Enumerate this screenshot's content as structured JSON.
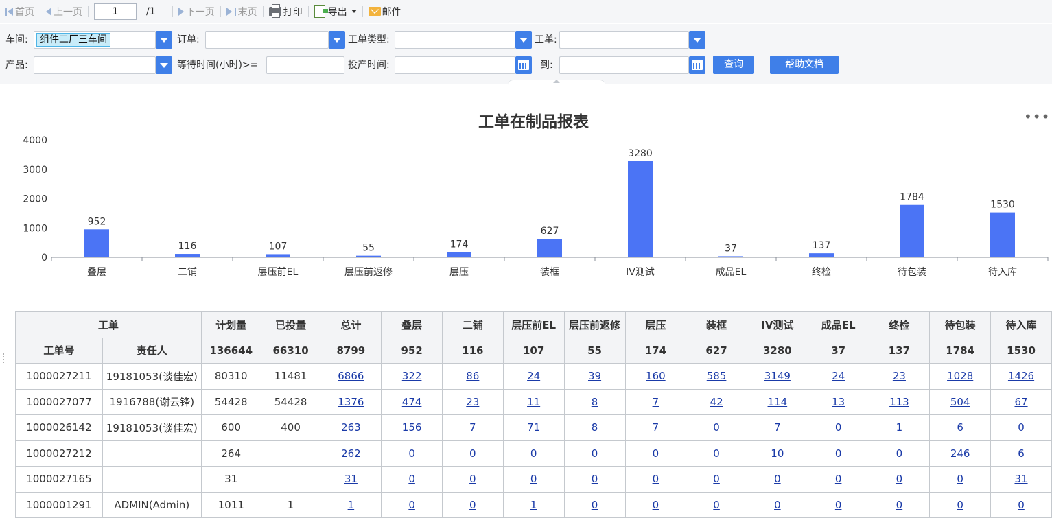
{
  "toolbar": {
    "first_label": "首页",
    "prev_label": "上一页",
    "page_value": "1",
    "page_total": "/1",
    "next_label": "下一页",
    "last_label": "末页",
    "print_label": "打印",
    "export_label": "导出",
    "mail_label": "邮件"
  },
  "filters": {
    "workshop_label": "车间:",
    "workshop_value": "组件二厂三车间",
    "order_label": "订单:",
    "wo_type_label": "工单类型:",
    "wo_label": "工单:",
    "product_label": "产品:",
    "wait_label": "等待时间(小时)>=",
    "start_label": "投产时间:",
    "to_label": "到:",
    "query_button": "查询",
    "help_button": "帮助文档"
  },
  "chart_data": {
    "type": "bar",
    "title": "工单在制品报表",
    "categories": [
      "叠层",
      "二铺",
      "层压前EL",
      "层压前返修",
      "层压",
      "装框",
      "IV测试",
      "成品EL",
      "终检",
      "待包装",
      "待入库"
    ],
    "values": [
      952,
      116,
      107,
      55,
      174,
      627,
      3280,
      37,
      137,
      1784,
      1530
    ],
    "ylim": [
      0,
      4000
    ],
    "yticks": [
      0,
      1000,
      2000,
      3000,
      4000
    ],
    "bar_color": "#4b74f5",
    "grid": false
  },
  "table": {
    "group_header": "工单",
    "headers": [
      "计划量",
      "已投量",
      "总计",
      "叠层",
      "二铺",
      "层压前EL",
      "层压前返修",
      "层压",
      "装框",
      "IV测试",
      "成品EL",
      "终检",
      "待包装",
      "待入库"
    ],
    "sub_headers": [
      "工单号",
      "责任人"
    ],
    "totals": [
      "136644",
      "66310",
      "8799",
      "952",
      "116",
      "107",
      "55",
      "174",
      "627",
      "3280",
      "37",
      "137",
      "1784",
      "1530"
    ],
    "rows": [
      [
        "1000027211",
        "19181053(谈佳宏)",
        "80310",
        "11481",
        "6866",
        "322",
        "86",
        "24",
        "39",
        "160",
        "585",
        "3149",
        "24",
        "23",
        "1028",
        "1426"
      ],
      [
        "1000027077",
        "1916788(谢云锋)",
        "54428",
        "54428",
        "1376",
        "474",
        "23",
        "11",
        "8",
        "7",
        "42",
        "114",
        "13",
        "113",
        "504",
        "67"
      ],
      [
        "1000026142",
        "19181053(谈佳宏)",
        "600",
        "400",
        "263",
        "156",
        "7",
        "71",
        "8",
        "7",
        "0",
        "7",
        "0",
        "1",
        "6",
        "0"
      ],
      [
        "1000027212",
        "",
        "264",
        "",
        "262",
        "0",
        "0",
        "0",
        "0",
        "0",
        "0",
        "10",
        "0",
        "0",
        "246",
        "6"
      ],
      [
        "1000027165",
        "",
        "31",
        "",
        "31",
        "0",
        "0",
        "0",
        "0",
        "0",
        "0",
        "0",
        "0",
        "0",
        "0",
        "31"
      ],
      [
        "1000001291",
        "ADMIN(Admin)",
        "1011",
        "1",
        "1",
        "0",
        "0",
        "1",
        "0",
        "0",
        "0",
        "0",
        "0",
        "0",
        "0",
        "0"
      ]
    ]
  }
}
